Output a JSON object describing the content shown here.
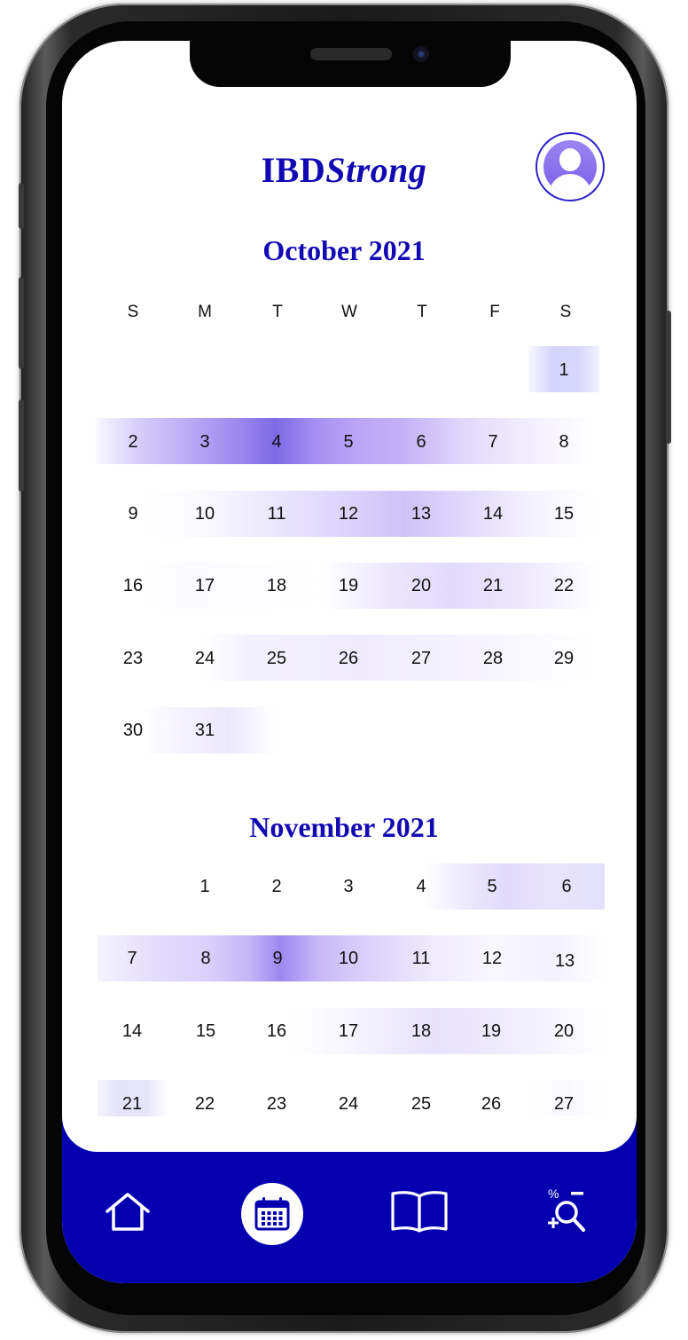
{
  "app": {
    "brand_prefix": "IBD",
    "brand_suffix": "Strong"
  },
  "weekdays": [
    "S",
    "M",
    "T",
    "W",
    "T",
    "F",
    "S"
  ],
  "months": [
    {
      "title": "October 2021",
      "days": [
        "1",
        "2",
        "3",
        "4",
        "5",
        "6",
        "7",
        "8",
        "9",
        "10",
        "11",
        "12",
        "13",
        "14",
        "15",
        "16",
        "17",
        "18",
        "19",
        "20",
        "21",
        "22",
        "23",
        "24",
        "25",
        "26",
        "27",
        "28",
        "29",
        "30",
        "31"
      ]
    },
    {
      "title": "November 2021",
      "days": [
        "1",
        "2",
        "3",
        "4",
        "5",
        "6",
        "7",
        "8",
        "9",
        "10",
        "11",
        "12",
        "13",
        "14",
        "15",
        "16",
        "17",
        "18",
        "19",
        "20",
        "21",
        "22",
        "23",
        "24",
        "25",
        "26",
        "27"
      ]
    }
  ],
  "nav": {
    "items": [
      "home-icon",
      "calendar-icon",
      "book-icon",
      "calculator-search-icon"
    ],
    "active": "calendar-icon"
  },
  "colors": {
    "brand": "#1209b3",
    "nav_bg": "#0400b0",
    "highlight": "#7b63ea"
  }
}
